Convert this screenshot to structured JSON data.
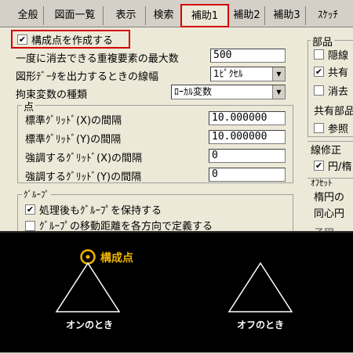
{
  "tabs": [
    {
      "label": "全般",
      "active": false
    },
    {
      "label": "図面一覧",
      "active": false
    },
    {
      "label": "表示",
      "active": false
    },
    {
      "label": "検索",
      "active": false
    },
    {
      "label": "補助1",
      "active": true
    },
    {
      "label": "補助2",
      "active": false
    },
    {
      "label": "補助3",
      "active": false
    },
    {
      "label": "ｽｹｯﾁ",
      "active": false
    }
  ],
  "construction_point": {
    "label": "構成点を作成する",
    "checked": true
  },
  "max_dup": {
    "label": "一度に消去できる重複要素の最大数",
    "value": "500"
  },
  "line_width": {
    "label": "図形ﾃﾞｰﾀを出力するときの線幅",
    "value": "1ﾋﾟｸｾﾙ"
  },
  "constraint": {
    "label": "拘束変数の種類",
    "value": "ﾛｰｶﾙ変数"
  },
  "point_group": {
    "title": "点",
    "rows": [
      {
        "label": "標準ｸﾞﾘｯﾄﾞ(X)の間隔",
        "value": "10.000000"
      },
      {
        "label": "標準ｸﾞﾘｯﾄﾞ(Y)の間隔",
        "value": "10.000000"
      },
      {
        "label": "強調するｸﾞﾘｯﾄﾞ(X)の間隔",
        "value": "0"
      },
      {
        "label": "強調するｸﾞﾘｯﾄﾞ(Y)の間隔",
        "value": "0"
      }
    ]
  },
  "group_box": {
    "title": "ｸﾞﾙｰﾌﾟ",
    "items": [
      {
        "label": "処理後もｸﾞﾙｰﾌﾟを保持する",
        "checked": true
      },
      {
        "label": "ｸﾞﾙｰﾌﾟの移動距離を各方向で定義する",
        "checked": false
      }
    ]
  },
  "right": {
    "parts_title": "部品",
    "parts_items": [
      {
        "label": "隠線",
        "checked": false
      },
      {
        "label": "共有",
        "checked": true
      },
      {
        "label": "消去",
        "checked": false
      }
    ],
    "shared_title": "共有部品",
    "shared_item": {
      "label": "参照",
      "checked": false
    },
    "line_fix_title": "線修正",
    "line_fix_item": {
      "label": "円/楕",
      "checked": true
    },
    "offset_title": "ｵﾌｾｯﾄ",
    "offset_lines": [
      "楕円の",
      "同心円"
    ],
    "bottom_cut": "子図"
  },
  "illustration": {
    "accent_label": "構成点",
    "left_label": "オンのとき",
    "right_label": "オフのとき",
    "accent_color": "#f0b400"
  }
}
